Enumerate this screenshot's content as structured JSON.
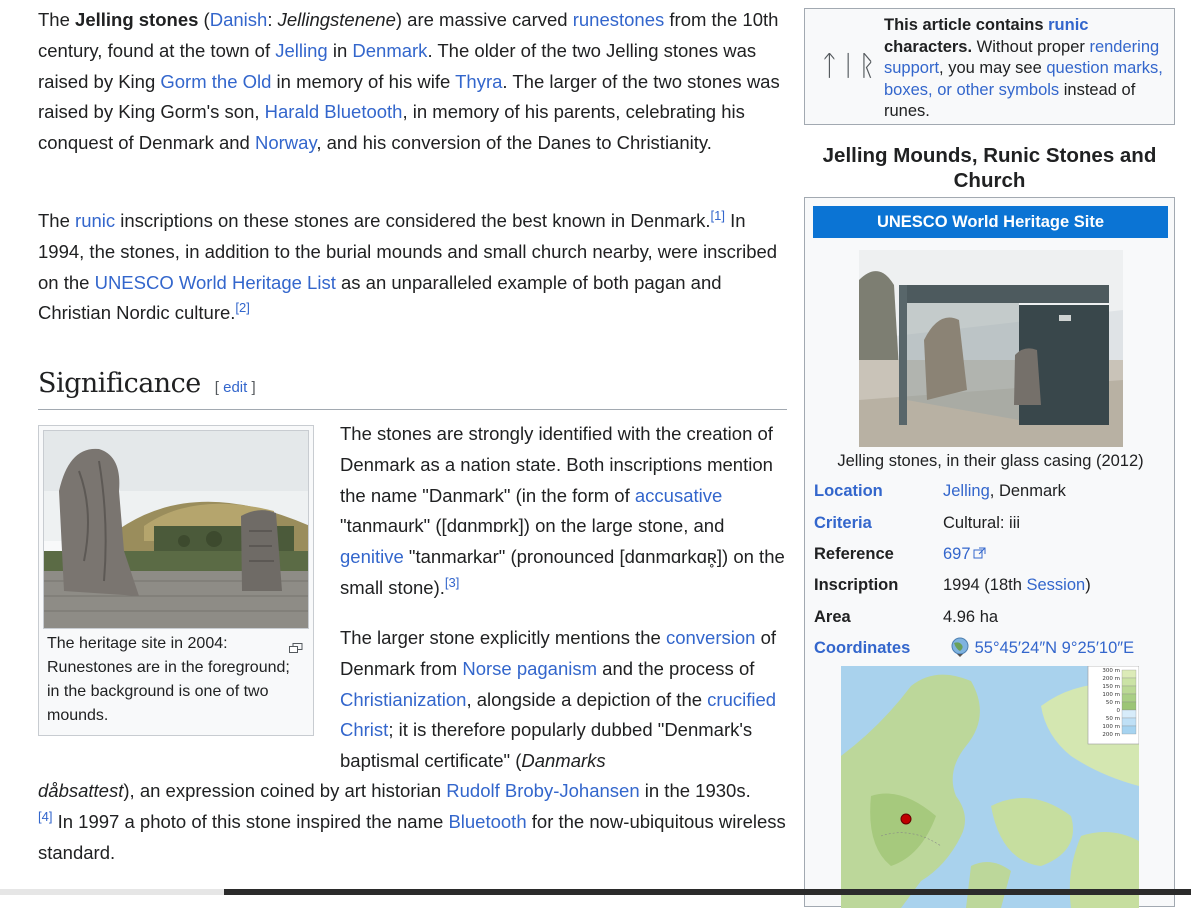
{
  "intro": {
    "p1": {
      "t1": "The ",
      "b1": "Jelling stones",
      "t2": " (",
      "l_danish": "Danish",
      "t3": ": ",
      "i1": "Jellingstenene",
      "t4": ") are massive carved ",
      "l_runestones": "runestones",
      "t5": " from the 10th century, found at the town of ",
      "l_jelling": "Jelling",
      "t6": " in ",
      "l_denmark": "Denmark",
      "t7": ". The older of the two Jelling stones was raised by King ",
      "l_gorm": "Gorm the Old",
      "t8": " in memory of his wife ",
      "l_thyra": "Thyra",
      "t9": ". The larger of the two stones was raised by King Gorm's son, ",
      "l_harald": "Harald Bluetooth",
      "t10": ", in memory of his parents, celebrating his conquest of Denmark and ",
      "l_norway": "Norway",
      "t11": ", and his conversion of the Danes to Christianity."
    },
    "p2": {
      "t1": "The ",
      "l_runic": "runic",
      "t2": " inscriptions on these stones are considered the best known in Denmark.",
      "ref1": "[1]",
      "t3": " In 1994, the stones, in addition to the burial mounds and small church nearby, were inscribed on the ",
      "l_unesco": "UNESCO World Heritage List",
      "t4": " as an unparalleled example of both pagan and Christian Nordic culture.",
      "ref2": "[2]"
    }
  },
  "section": {
    "title": "Significance",
    "edit": "edit",
    "bracket_open": "[ ",
    "bracket_close": " ]"
  },
  "thumb": {
    "caption": "The heritage site in 2004: Runestones are in the foreground; in the background is one of two mounds.",
    "enlarge_icon": "enlarge-icon"
  },
  "significance": {
    "p3": {
      "t1": "The stones are strongly identified with the creation of Denmark as a nation state. Both inscriptions mention the name \"Danmark\" (in the form of ",
      "l_acc": "accusative",
      "t2": " \"tanmaurk\" ([dɑnmɒrk]) on the large stone, and ",
      "l_gen": "genitive",
      "t3": " \"tanmarkar\" (pronounced [dɑnmɑrkɑʀ̥]) on the small stone).",
      "ref3": "[3]"
    },
    "p4": {
      "t1": "The larger stone explicitly mentions the ",
      "l_conv": "conversion",
      "t2": " of Denmark from ",
      "l_norse": "Norse paganism",
      "t3": " and the process of ",
      "l_christ": "Christianization",
      "t4": ", alongside a depiction of the ",
      "l_cruc": "crucified Christ",
      "t5": "; it is therefore popularly dubbed \"Denmark's baptismal certificate\" (",
      "i1": "Danmarks",
      "i2": "dåbsattest",
      "t6": "), an expression coined by art historian ",
      "l_rudolf": "Rudolf Broby-Johansen",
      "t7": " in the 1930s.",
      "ref4": "[4]",
      "t8": " In 1997 a photo of this stone inspired the name ",
      "l_bluetooth": "Bluetooth",
      "t9": " for the now-ubiquitous wireless standard."
    }
  },
  "notice": {
    "runes": "ᛏᛁᚱ",
    "b1": "This article contains ",
    "l_runic": "runic",
    "b2": " characters.",
    "t1": " Without proper ",
    "l_render": "rendering support",
    "t2": ", you may see ",
    "l_marks": "question marks, boxes, or other symbols",
    "t3": " instead of runes."
  },
  "infobox": {
    "title": "Jelling Mounds, Runic Stones and Church",
    "band": "UNESCO World Heritage Site",
    "photo_caption": "Jelling stones, in their glass casing (2012)",
    "rows": [
      {
        "label": "Location",
        "label_link": true,
        "v_link": "Jelling",
        "v_text": ", Denmark"
      },
      {
        "label": "Criteria",
        "label_link": true,
        "v_text": "Cultural: iii"
      },
      {
        "label": "Reference",
        "v_link": "697"
      },
      {
        "label": "Inscription",
        "v_text": "1994 (18th ",
        "v_link2": "Session",
        "v_text2": ")"
      },
      {
        "label": "Area",
        "v_text": "4.96 ha"
      },
      {
        "label": "Coordinates",
        "label_link": true,
        "v_link": "55°45′24″N 9°25′10″E"
      }
    ],
    "map_legend": [
      "300 m",
      "200 m",
      "150 m",
      "100 m",
      "50 m",
      "0",
      "50 m",
      "100 m",
      "200 m"
    ]
  },
  "colors": {
    "link": "#3366cc",
    "band": "#0b74d4",
    "border": "#a2a9b1"
  }
}
